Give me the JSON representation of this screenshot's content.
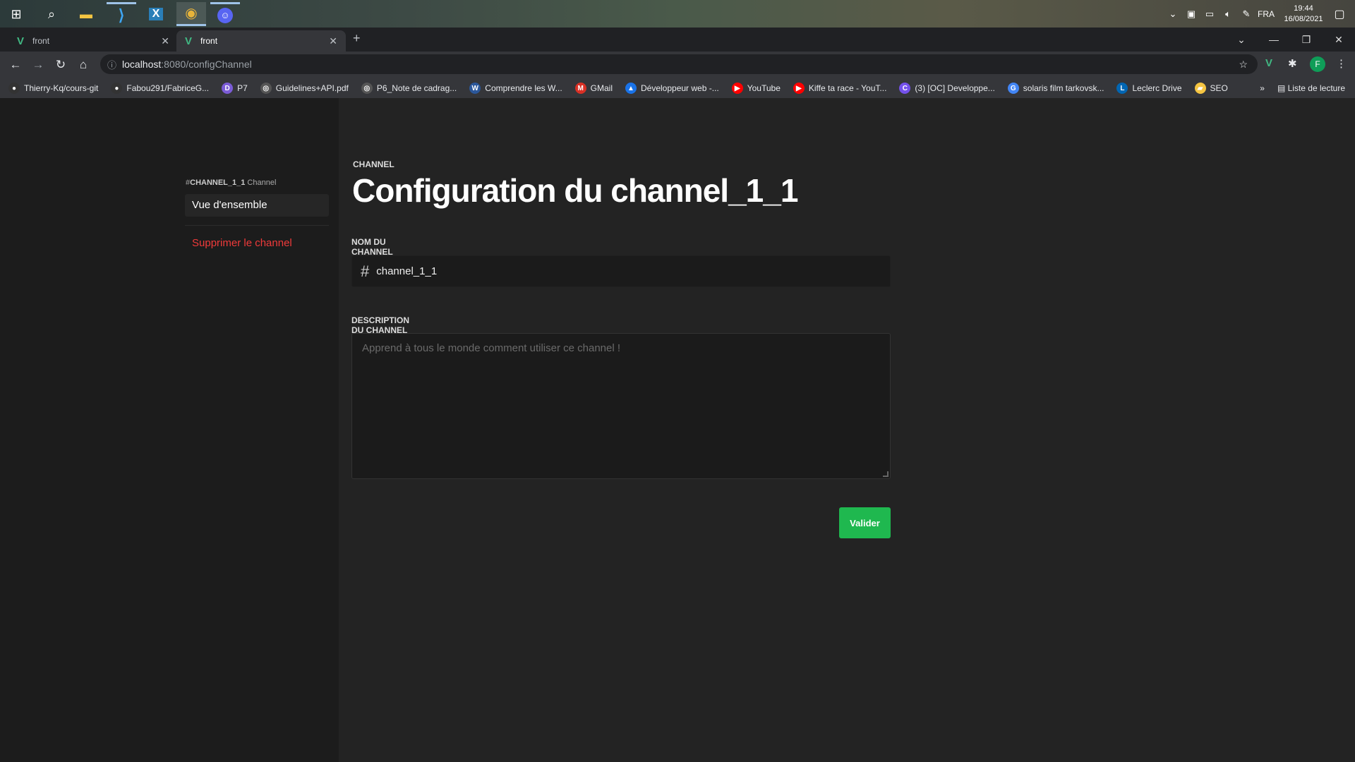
{
  "taskbar": {
    "apps": [
      {
        "name": "windows-start-icon",
        "glyph": "⊞"
      },
      {
        "name": "search-icon",
        "glyph": "⌕"
      },
      {
        "name": "file-explorer-icon",
        "glyph": "▬"
      },
      {
        "name": "vscode-icon",
        "glyph": "⟩"
      },
      {
        "name": "xampp-icon",
        "glyph": "X"
      },
      {
        "name": "chrome-icon",
        "glyph": "◉"
      },
      {
        "name": "discord-icon",
        "glyph": "☺"
      }
    ],
    "language": "FRA",
    "time": "19:44",
    "date": "16/08/2021"
  },
  "browser": {
    "tabs": [
      {
        "title": "front",
        "active": false
      },
      {
        "title": "front",
        "active": true
      }
    ],
    "url_host": "localhost",
    "url_rest": ":8080/configChannel",
    "profile_initial": "F",
    "bookmarks": [
      {
        "label": "Thierry-Kq/cours-git",
        "icon": "github-icon",
        "color": "#333333"
      },
      {
        "label": "Fabou291/FabriceG...",
        "icon": "github-icon",
        "color": "#333333"
      },
      {
        "label": "P7",
        "icon": "bookmark-icon",
        "color": "#7b5cd6"
      },
      {
        "label": "Guidelines+API.pdf",
        "icon": "globe-icon",
        "color": "#555555"
      },
      {
        "label": "P6_Note de cadrag...",
        "icon": "globe-icon",
        "color": "#555555"
      },
      {
        "label": "Comprendre les W...",
        "icon": "word-icon",
        "color": "#2b579a"
      },
      {
        "label": "GMail",
        "icon": "gmail-icon",
        "color": "#d93025"
      },
      {
        "label": "Développeur web -...",
        "icon": "drive-icon",
        "color": "#1a73e8"
      },
      {
        "label": "YouTube",
        "icon": "youtube-icon",
        "color": "#ff0000"
      },
      {
        "label": "Kiffe ta race - YouT...",
        "icon": "youtube-icon",
        "color": "#ff0000"
      },
      {
        "label": "(3) [OC] Developpe...",
        "icon": "oc-icon",
        "color": "#7451eb"
      },
      {
        "label": "solaris film tarkovsk...",
        "icon": "google-icon",
        "color": "#4285f4"
      },
      {
        "label": "Leclerc Drive",
        "icon": "leclerc-icon",
        "color": "#0066b3"
      },
      {
        "label": "SEO",
        "icon": "folder-icon",
        "color": "#f5c542"
      }
    ],
    "more_bookmarks": "»",
    "reading_list": "Liste de lecture"
  },
  "sidebar": {
    "channel_hash": "#",
    "channel_name": "CHANNEL_1_1",
    "channel_suffix": " Channel",
    "items": [
      {
        "label": "Vue d'ensemble"
      },
      {
        "label": "Supprimer le channel"
      }
    ]
  },
  "main": {
    "eyebrow": "CHANNEL",
    "title": "Configuration du channel_1_1",
    "name_label": "NOM DU CHANNEL",
    "name_value": "channel_1_1",
    "desc_label": "DESCRIPTION DU CHANNEL",
    "desc_placeholder": "Apprend à tous le monde comment utiliser ce channel !",
    "submit_label": "Valider"
  },
  "colors": {
    "accent_green": "#1fb84f",
    "danger_red": "#f03a3a",
    "vue_green": "#41b883"
  }
}
